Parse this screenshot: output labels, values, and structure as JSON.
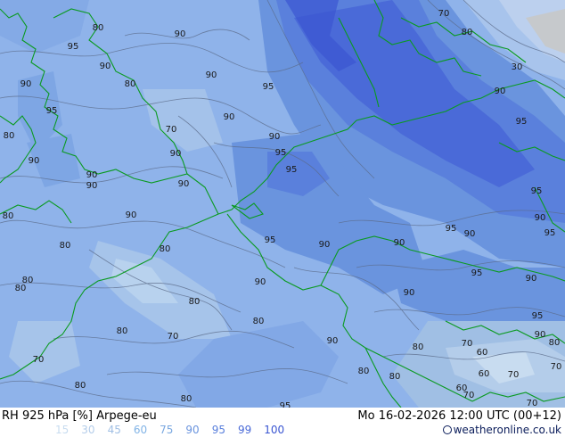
{
  "map": {
    "contour_labels": [
      {
        "text": "80",
        "pos": "nw-1"
      },
      {
        "text": "95",
        "pos": "nw-2"
      },
      {
        "text": "90",
        "pos": "nw-3"
      },
      {
        "text": "90",
        "pos": "nw-4"
      },
      {
        "text": "80",
        "pos": "nw-5"
      },
      {
        "text": "90",
        "pos": "nw-6"
      },
      {
        "text": "95",
        "pos": "nw-7"
      },
      {
        "text": "80",
        "pos": "nw-8"
      },
      {
        "text": "90",
        "pos": "nw-9"
      },
      {
        "text": "90",
        "pos": "n-1"
      },
      {
        "text": "90",
        "pos": "n-2"
      },
      {
        "text": "95",
        "pos": "n-3"
      },
      {
        "text": "90",
        "pos": "n-4"
      },
      {
        "text": "70",
        "pos": "n-5"
      },
      {
        "text": "90",
        "pos": "n-6"
      },
      {
        "text": "90",
        "pos": "n-7"
      },
      {
        "text": "95",
        "pos": "n-8"
      },
      {
        "text": "95",
        "pos": "n-9"
      },
      {
        "text": "90",
        "pos": "w-1"
      },
      {
        "text": "90",
        "pos": "w-2"
      },
      {
        "text": "90",
        "pos": "w-3"
      },
      {
        "text": "80",
        "pos": "w-4"
      },
      {
        "text": "80",
        "pos": "w-5"
      },
      {
        "text": "80",
        "pos": "w-6"
      },
      {
        "text": "80",
        "pos": "w-7"
      },
      {
        "text": "80",
        "pos": "w-8"
      },
      {
        "text": "95",
        "pos": "c-1"
      },
      {
        "text": "90",
        "pos": "c-2"
      },
      {
        "text": "90",
        "pos": "c-3"
      },
      {
        "text": "90",
        "pos": "c-4"
      },
      {
        "text": "80",
        "pos": "c-5"
      },
      {
        "text": "80",
        "pos": "c-6"
      },
      {
        "text": "70",
        "pos": "c-7"
      },
      {
        "text": "80",
        "pos": "sw-1"
      },
      {
        "text": "70",
        "pos": "sw-2"
      },
      {
        "text": "80",
        "pos": "sw-3"
      },
      {
        "text": "80",
        "pos": "sw-4"
      },
      {
        "text": "90",
        "pos": "s-1"
      },
      {
        "text": "95",
        "pos": "s-2"
      },
      {
        "text": "90",
        "pos": "c-8"
      },
      {
        "text": "80",
        "pos": "s-3"
      },
      {
        "text": "80",
        "pos": "s-4"
      },
      {
        "text": "70",
        "pos": "ne-1"
      },
      {
        "text": "80",
        "pos": "ne-2"
      },
      {
        "text": "30",
        "pos": "ne-3"
      },
      {
        "text": "90",
        "pos": "ne-4"
      },
      {
        "text": "95",
        "pos": "ne-5"
      },
      {
        "text": "95",
        "pos": "e-1"
      },
      {
        "text": "90",
        "pos": "e-2"
      },
      {
        "text": "95",
        "pos": "e-3"
      },
      {
        "text": "90",
        "pos": "e-4"
      },
      {
        "text": "95",
        "pos": "e-5"
      },
      {
        "text": "95",
        "pos": "e-6"
      },
      {
        "text": "90",
        "pos": "e-7"
      },
      {
        "text": "95",
        "pos": "e-8"
      },
      {
        "text": "90",
        "pos": "e-9"
      },
      {
        "text": "80",
        "pos": "se-1"
      },
      {
        "text": "70",
        "pos": "se-2"
      },
      {
        "text": "60",
        "pos": "se-3"
      },
      {
        "text": "70",
        "pos": "se-4"
      },
      {
        "text": "60",
        "pos": "se-5"
      },
      {
        "text": "70",
        "pos": "se-6"
      },
      {
        "text": "60",
        "pos": "se-7"
      },
      {
        "text": "70",
        "pos": "se-8"
      },
      {
        "text": "70",
        "pos": "se-9"
      },
      {
        "text": "80",
        "pos": "se-10"
      }
    ]
  },
  "footer": {
    "title": "RH 925 hPa [%] Arpege-eu",
    "datetime": "Mo 16-02-2026 12:00 UTC (00+12)",
    "legend": [
      {
        "label": "15",
        "color": "#c8dcf0"
      },
      {
        "label": "30",
        "color": "#b4cdea"
      },
      {
        "label": "45",
        "color": "#a0bfe4"
      },
      {
        "label": "60",
        "color": "#82b4e6"
      },
      {
        "label": "75",
        "color": "#7aa8e0"
      },
      {
        "label": "90",
        "color": "#6a94de"
      },
      {
        "label": "95",
        "color": "#5a80dc"
      },
      {
        "label": "99",
        "color": "#4a6ad8"
      },
      {
        "label": "100",
        "color": "#3a56d2"
      }
    ],
    "credit": "weatheronline.co.uk"
  },
  "colors": {
    "base": "#8fb3ea",
    "coast": "#0a9a20",
    "contour": "#5a6a88"
  }
}
